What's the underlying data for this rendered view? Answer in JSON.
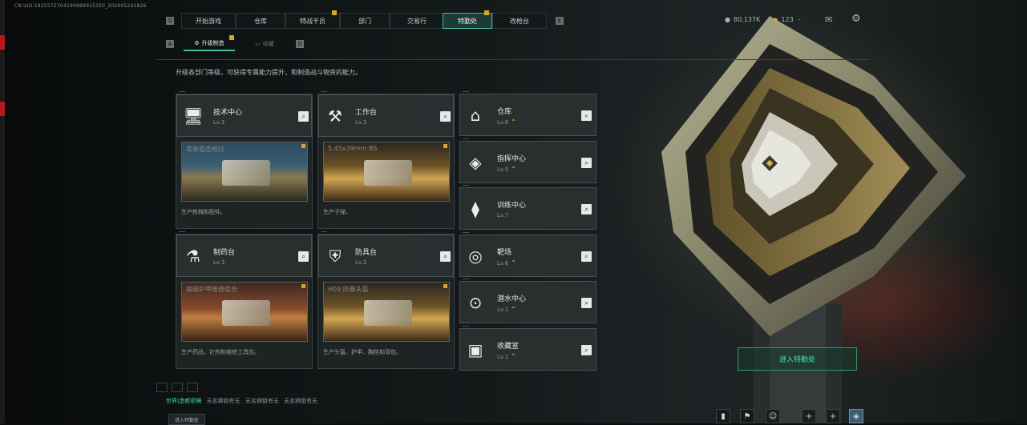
{
  "uid": "CN UID:1825572704199989915350_202605241826",
  "nav": {
    "tabs": [
      {
        "label": "开始游戏",
        "active": false,
        "badge": false
      },
      {
        "label": "仓库",
        "active": false,
        "badge": false
      },
      {
        "label": "特战干员",
        "active": false,
        "badge": true
      },
      {
        "label": "部门",
        "active": false,
        "badge": false
      },
      {
        "label": "交易行",
        "active": false,
        "badge": false
      },
      {
        "label": "特勤处",
        "active": true,
        "badge": true
      },
      {
        "label": "改枪台",
        "active": false,
        "badge": false
      }
    ],
    "left_key": "Q",
    "right_key": "E"
  },
  "currency": {
    "coins": "80,137K",
    "tickets": "123"
  },
  "subtabs": [
    {
      "label": "升级制造",
      "active": true,
      "icon": "gear-icon"
    },
    {
      "label": "收藏",
      "active": false,
      "icon": "box-icon"
    }
  ],
  "description": "升级各部门等级，可获得专属能力提升，和制造战斗物资的能力。",
  "workbenches": [
    {
      "name": "技术中心",
      "level": "Lv.3",
      "icon": "monitor-icon",
      "thumb_title": "骨架狙击枪托",
      "thumb_desc": "生产枪械和配件。"
    },
    {
      "name": "工作台",
      "level": "Lv.3",
      "icon": "tools-icon",
      "thumb_title": "5.45x39mm BS",
      "thumb_desc": "生产子弹。"
    },
    {
      "name": "制药台",
      "level": "Lv.3",
      "icon": "microscope-icon",
      "thumb_title": "高级护甲维修组合",
      "thumb_desc": "生产药品、针剂和维修工具包。"
    },
    {
      "name": "防具台",
      "level": "Lv.3",
      "icon": "armor-icon",
      "thumb_title": "H09 防暴头盔",
      "thumb_desc": "生产头盔、护甲、胸挂和背包。"
    }
  ],
  "departments": [
    {
      "name": "仓库",
      "level": "Lv.8",
      "icon": "warehouse-icon",
      "upgrade": true
    },
    {
      "name": "指挥中心",
      "level": "Lv.5",
      "icon": "command-icon",
      "upgrade": true
    },
    {
      "name": "训练中心",
      "level": "Lv.7",
      "icon": "dumbbell-icon",
      "upgrade": false
    },
    {
      "name": "靶场",
      "level": "Lv.6",
      "icon": "target-icon",
      "upgrade": true
    },
    {
      "name": "潜水中心",
      "level": "Lv.1",
      "icon": "dive-icon",
      "upgrade": true
    },
    {
      "name": "收藏室",
      "level": "Lv.1",
      "icon": "collection-icon",
      "upgrade": true
    }
  ],
  "enter_button": "进入特勤处",
  "ticker": {
    "highlight": "世界|造都密稿",
    "items": [
      "无名狮狙有无",
      "无名狮狙有无",
      "无名狮狙有无"
    ]
  },
  "chat_button": "进入特勤处",
  "colors": {
    "accent": "#3fbf95",
    "gold": "#d9a628",
    "enter_text": "#47e6a6"
  }
}
